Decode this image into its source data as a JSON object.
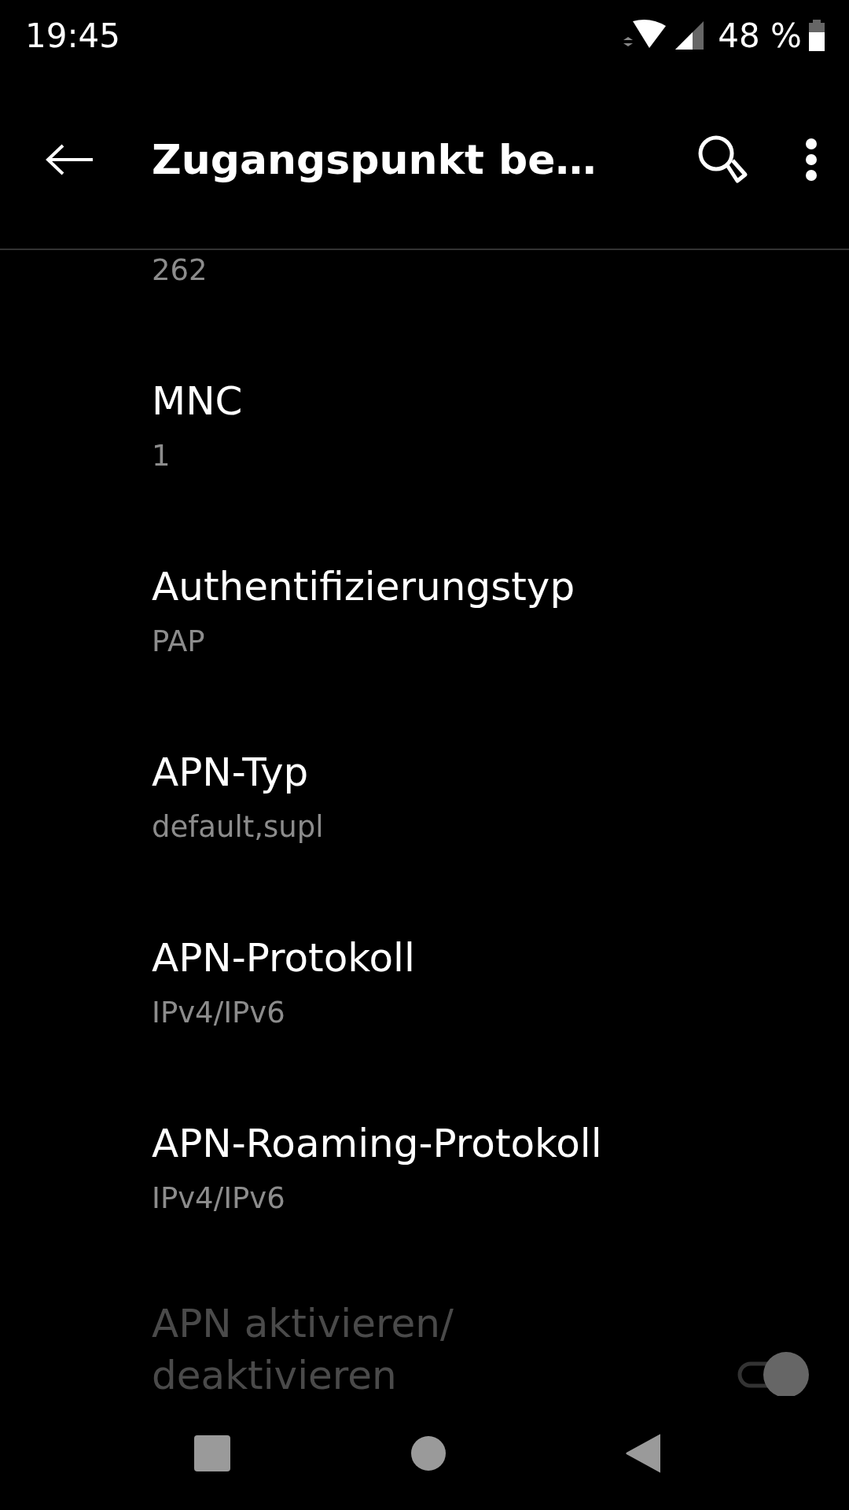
{
  "status_bar": {
    "time": "19:45",
    "battery": "48 %"
  },
  "toolbar": {
    "title": "Zugangspunkt be…"
  },
  "items": [
    {
      "kind": "value",
      "value": "262"
    },
    {
      "kind": "text",
      "title": "MNC",
      "value": "1"
    },
    {
      "kind": "text",
      "title": "Authentifizierungstyp",
      "value": "PAP"
    },
    {
      "kind": "text",
      "title": "APN-Typ",
      "value": "default,supl"
    },
    {
      "kind": "text",
      "title": "APN-Protokoll",
      "value": "IPv4/IPv6"
    },
    {
      "kind": "text",
      "title": "APN-Roaming-Protokoll",
      "value": "IPv4/IPv6"
    },
    {
      "kind": "switch",
      "title": "APN aktivieren/ deaktivieren",
      "disabled": true,
      "on": true
    }
  ]
}
